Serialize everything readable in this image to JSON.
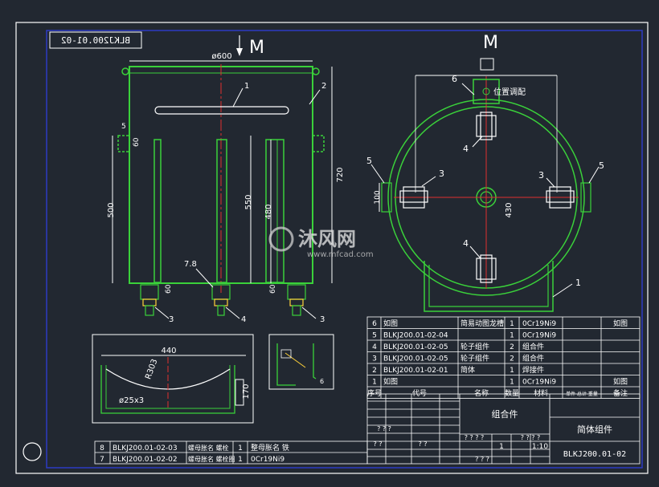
{
  "drawing": {
    "code_stamp": "BLKJ200.01-02",
    "view_label_left": "M",
    "view_label_right": "M",
    "watermark_brand": "沐风网",
    "watermark_url": "www.mfcad.com"
  },
  "front_view": {
    "dim_width": "ø600",
    "dim_height_total": "720",
    "dim_inner_left": "500",
    "dim_inner_center": "550",
    "dim_inner_right": "480",
    "dim_bracket_w": "5",
    "dim_bracket_h": "60",
    "dim_bottom_left": "60",
    "dim_bottom_right": "60",
    "dim_78": "7.8",
    "balloons": [
      "1",
      "2",
      "3",
      "4",
      "3"
    ]
  },
  "top_view": {
    "note_position": "位置调配",
    "dim_100": "100",
    "dim_430": "430",
    "balloons": [
      "6",
      "4",
      "3",
      "5",
      "3",
      "5",
      "4",
      "1"
    ]
  },
  "detail_view": {
    "dim_width": "440",
    "dim_radius": "R303",
    "dim_height": "170",
    "dim_holes": "ø25x3"
  },
  "small_detail": {
    "dim_6": "6"
  },
  "parts_list": {
    "rows": [
      {
        "no": "6",
        "code": "如图",
        "name": "简易动图龙槽",
        "qty": "1",
        "material": "0Cr19Ni9",
        "remark": "如图"
      },
      {
        "no": "5",
        "code": "BLKJ200.01-02-04",
        "name": "",
        "qty": "1",
        "material": "0Cr19Ni9",
        "remark": ""
      },
      {
        "no": "4",
        "code": "BLKJ200.01-02-05",
        "name": "轮子组件",
        "qty": "2",
        "material": "组合件",
        "remark": ""
      },
      {
        "no": "3",
        "code": "BLKJ200.01-02-05",
        "name": "轮子组件",
        "qty": "2",
        "material": "组合件",
        "remark": ""
      },
      {
        "no": "2",
        "code": "BLKJ200.01-02-01",
        "name": "简体",
        "qty": "1",
        "material": "焊接件",
        "remark": ""
      },
      {
        "no": "1",
        "code": "如图",
        "name": "",
        "qty": "1",
        "material": "0Cr19Ni9",
        "remark": "如图"
      }
    ],
    "headers": [
      "序号",
      "代号",
      "名称",
      "数量",
      "材料",
      "单件 总计 重量",
      "备注"
    ]
  },
  "title_block": {
    "material_label": "组合件",
    "drawing_name": "简体组件",
    "drawing_code": "BLKJ200.01-02",
    "scale": "1:10",
    "qty": "1",
    "placeholders": [
      "? ? ? ?",
      "? ? ? ?",
      "? ? ?",
      "? ?",
      "? ?",
      "? ? ?"
    ]
  },
  "lower_list": {
    "rows": [
      {
        "no": "8",
        "code": "BLKJ200.01-02-03",
        "name": "螺母胀名 螺栓",
        "qty": "1",
        "material": "整母胀名 铁"
      },
      {
        "no": "7",
        "code": "BLKJ200.01-02-02",
        "name": "螺母胀名 螺栓圈",
        "qty": "1",
        "material": "0Cr19Ni9"
      }
    ]
  }
}
